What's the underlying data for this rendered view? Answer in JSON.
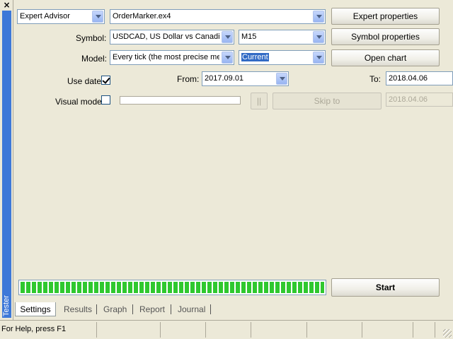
{
  "side": {
    "label": "Tester",
    "close_glyph": "×"
  },
  "settings": {
    "expert_type": "Expert Advisor",
    "expert_file": "OrderMarker.ex4",
    "expert_properties_button": "Expert properties",
    "symbol_label": "Symbol:",
    "symbol_value": "USDCAD, US Dollar vs Canadi",
    "period_value": "M15",
    "symbol_properties_button": "Symbol properties",
    "model_label": "Model:",
    "model_value": "Every tick (the most precise me",
    "spread_value": "Current",
    "open_chart_button": "Open chart",
    "use_date_label": "Use date",
    "use_date_checked": true,
    "from_label": "From:",
    "from_value": "2017.09.01",
    "to_label": "To:",
    "to_value": "2018.04.06",
    "visual_mode_label": "Visual mode",
    "visual_mode_checked": false,
    "pause_button": "||",
    "skip_to_button": "Skip to",
    "skip_to_value": "2018.04.06",
    "progress": 1.0,
    "start_button": "Start"
  },
  "tabs": [
    {
      "label": "Settings",
      "active": true
    },
    {
      "label": "Results",
      "active": false
    },
    {
      "label": "Graph",
      "active": false
    },
    {
      "label": "Report",
      "active": false
    },
    {
      "label": "Journal",
      "active": false
    }
  ],
  "statusbar": {
    "text": "For Help, press F1"
  },
  "colors": {
    "accent": "#3d78d8",
    "progress": "#2fc82f",
    "selection": "#316ac5"
  }
}
